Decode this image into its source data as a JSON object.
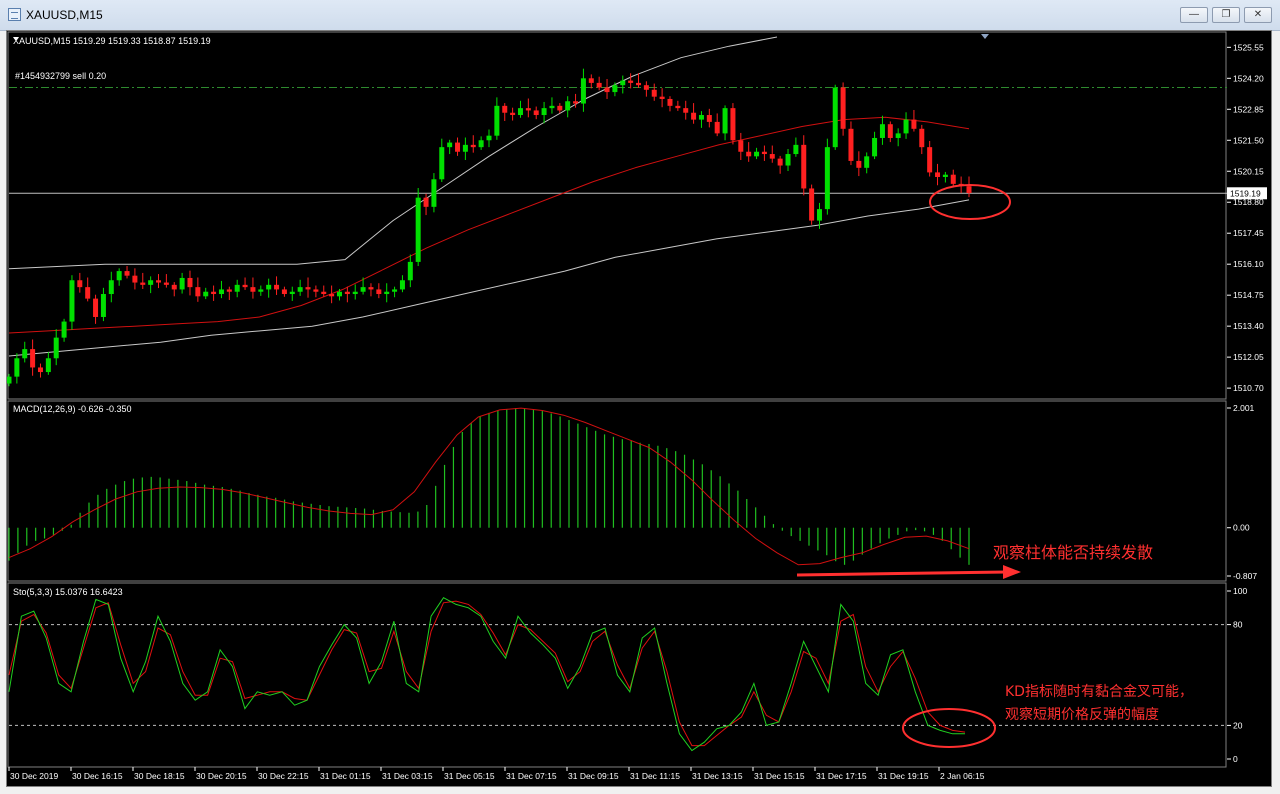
{
  "window": {
    "title": "XAUUSD,M15",
    "buttons": [
      "minimize",
      "restore",
      "close"
    ]
  },
  "colors": {
    "background": "#000000",
    "bull_candle": "#00e000",
    "bear_candle": "#ff2020",
    "ma": "#d01010",
    "bands": "#c8c8c8",
    "macd_hist": "#20c020",
    "macd_signal": "#d01010",
    "sto_main": "#20d020",
    "sto_signal": "#e01010",
    "annotation": "#ff3030"
  },
  "chart_data": [
    {
      "type": "candlestick",
      "header": "XAUUSD,M15  1519.29 1519.33 1518.87 1519.19",
      "order_label": "#1454932799 sell 0.20",
      "order_level": 1523.8,
      "current_price": 1519.19,
      "current_price_label": "1519.19",
      "ylim": [
        1510.4,
        1526.0
      ],
      "y_ticks": [
        "1525.55",
        "1524.20",
        "1522.85",
        "1521.50",
        "1520.15",
        "1518.80",
        "1517.45",
        "1516.10",
        "1514.75",
        "1513.40",
        "1512.05",
        "1510.70"
      ],
      "x_ticks": [
        "30 Dec 2019",
        "30 Dec 16:15",
        "30 Dec 18:15",
        "30 Dec 20:15",
        "30 Dec 22:15",
        "31 Dec 01:15",
        "31 Dec 03:15",
        "31 Dec 05:15",
        "31 Dec 07:15",
        "31 Dec 09:15",
        "31 Dec 11:15",
        "31 Dec 13:15",
        "31 Dec 15:15",
        "31 Dec 17:15",
        "31 Dec 19:15",
        "2 Jan 06:15"
      ],
      "close_path": [
        1511.2,
        1512.0,
        1512.4,
        1511.6,
        1511.4,
        1512.0,
        1512.9,
        1513.6,
        1515.4,
        1515.1,
        1514.6,
        1513.8,
        1514.8,
        1515.4,
        1515.8,
        1515.6,
        1515.3,
        1515.2,
        1515.4,
        1515.3,
        1515.2,
        1515.0,
        1515.5,
        1515.1,
        1514.7,
        1514.9,
        1514.8,
        1515.0,
        1514.9,
        1515.2,
        1515.1,
        1514.9,
        1515.0,
        1515.2,
        1515.0,
        1514.8,
        1514.9,
        1515.1,
        1515.0,
        1514.9,
        1514.8,
        1514.7,
        1514.9,
        1514.8,
        1514.9,
        1515.1,
        1515.0,
        1514.8,
        1514.9,
        1515.0,
        1515.4,
        1516.2,
        1519.0,
        1518.6,
        1519.8,
        1521.2,
        1521.4,
        1521.0,
        1521.3,
        1521.2,
        1521.5,
        1521.7,
        1523.0,
        1522.7,
        1522.6,
        1522.9,
        1522.8,
        1522.6,
        1522.9,
        1523.0,
        1522.8,
        1523.2,
        1523.1,
        1524.2,
        1524.0,
        1523.8,
        1523.6,
        1523.9,
        1524.1,
        1524.0,
        1523.9,
        1523.7,
        1523.4,
        1523.3,
        1523.0,
        1522.9,
        1522.7,
        1522.4,
        1522.6,
        1522.3,
        1521.8,
        1522.9,
        1521.5,
        1521.0,
        1520.8,
        1521.0,
        1520.9,
        1520.7,
        1520.4,
        1520.9,
        1521.3,
        1519.4,
        1518.0,
        1518.5,
        1521.2,
        1523.8,
        1522.0,
        1520.6,
        1520.3,
        1520.8,
        1521.6,
        1522.2,
        1521.6,
        1521.8,
        1522.4,
        1522.0,
        1521.2,
        1520.1,
        1519.9,
        1520.0,
        1519.6,
        1519.5,
        1519.2
      ],
      "series": [
        {
          "name": "candles_close",
          "values": "close_path"
        },
        {
          "name": "ma",
          "values": [
            1513.1,
            1513.2,
            1513.3,
            1513.4,
            1513.5,
            1513.6,
            1513.8,
            1514.3,
            1515.0,
            1515.9,
            1516.8,
            1517.6,
            1518.3,
            1519.0,
            1519.7,
            1520.3,
            1520.8,
            1521.3,
            1521.7,
            1522.1,
            1522.4,
            1522.5,
            1522.3,
            1522.0
          ]
        },
        {
          "name": "upper_band",
          "values": [
            1515.9,
            1516.0,
            1516.1,
            1516.1,
            1516.1,
            1516.1,
            1516.1,
            1516.3,
            1518.0,
            1519.4,
            1520.8,
            1522.1,
            1523.3,
            1524.3,
            1525.1,
            1525.6,
            1526.0
          ]
        },
        {
          "name": "lower_band",
          "values": [
            1512.1,
            1512.3,
            1512.5,
            1512.7,
            1513.0,
            1513.2,
            1513.4,
            1513.8,
            1514.3,
            1514.8,
            1515.3,
            1515.8,
            1516.4,
            1516.8,
            1517.2,
            1517.5,
            1517.8,
            1518.2,
            1518.5,
            1518.9
          ]
        }
      ]
    },
    {
      "type": "bar",
      "header": "MACD(12,26,9) -0.626 -0.350",
      "y_ticks": [
        "2.001",
        "0.00",
        "-0.807"
      ],
      "ylim": [
        -0.807,
        2.001
      ],
      "hist": [
        -0.55,
        -0.42,
        -0.3,
        -0.22,
        -0.18,
        -0.12,
        -0.05,
        0.05,
        0.25,
        0.42,
        0.55,
        0.65,
        0.72,
        0.78,
        0.82,
        0.84,
        0.85,
        0.84,
        0.82,
        0.8,
        0.78,
        0.75,
        0.72,
        0.7,
        0.68,
        0.65,
        0.62,
        0.58,
        0.55,
        0.52,
        0.5,
        0.47,
        0.44,
        0.42,
        0.4,
        0.38,
        0.36,
        0.35,
        0.34,
        0.33,
        0.32,
        0.3,
        0.28,
        0.27,
        0.26,
        0.25,
        0.27,
        0.38,
        0.7,
        1.05,
        1.35,
        1.6,
        1.75,
        1.86,
        1.92,
        1.96,
        1.98,
        2.0,
        2.0,
        1.98,
        1.95,
        1.91,
        1.86,
        1.8,
        1.74,
        1.68,
        1.62,
        1.56,
        1.52,
        1.48,
        1.45,
        1.42,
        1.4,
        1.37,
        1.33,
        1.28,
        1.22,
        1.14,
        1.06,
        0.96,
        0.86,
        0.74,
        0.62,
        0.48,
        0.34,
        0.2,
        0.06,
        -0.05,
        -0.14,
        -0.22,
        -0.3,
        -0.38,
        -0.46,
        -0.56,
        -0.62,
        -0.55,
        -0.45,
        -0.35,
        -0.26,
        -0.18,
        -0.12,
        -0.06,
        -0.04,
        -0.06,
        -0.12,
        -0.22,
        -0.36,
        -0.5,
        -0.62
      ],
      "series": [
        {
          "name": "signal",
          "values": [
            -0.5,
            -0.35,
            -0.15,
            0.1,
            0.3,
            0.48,
            0.6,
            0.66,
            0.68,
            0.67,
            0.64,
            0.58,
            0.5,
            0.42,
            0.34,
            0.28,
            0.24,
            0.22,
            0.3,
            0.6,
            1.1,
            1.55,
            1.85,
            1.97,
            2.0,
            1.96,
            1.88,
            1.76,
            1.62,
            1.48,
            1.34,
            1.1,
            0.8,
            0.45,
            0.12,
            -0.18,
            -0.42,
            -0.62,
            -0.6,
            -0.5,
            -0.42,
            -0.28,
            -0.16,
            -0.14,
            -0.22,
            -0.35
          ]
        }
      ]
    },
    {
      "type": "line",
      "header": "Sto(5,3,3) 15.0376 16.6423",
      "y_ticks": [
        "100",
        "80",
        "20",
        "0"
      ],
      "ylim": [
        0,
        100
      ],
      "levels": [
        80,
        20
      ],
      "series": [
        {
          "name": "main",
          "values": [
            40,
            85,
            88,
            72,
            45,
            40,
            70,
            95,
            92,
            60,
            40,
            58,
            85,
            70,
            45,
            35,
            40,
            65,
            55,
            30,
            40,
            38,
            40,
            32,
            35,
            55,
            68,
            80,
            72,
            45,
            58,
            82,
            45,
            40,
            85,
            96,
            92,
            90,
            85,
            70,
            60,
            85,
            75,
            68,
            60,
            42,
            55,
            75,
            78,
            50,
            40,
            72,
            78,
            45,
            15,
            5,
            10,
            18,
            20,
            28,
            45,
            20,
            22,
            45,
            70,
            55,
            40,
            92,
            82,
            45,
            38,
            62,
            65,
            40,
            20,
            17,
            15,
            15
          ]
        },
        {
          "name": "signal",
          "values": [
            50,
            82,
            86,
            75,
            50,
            42,
            66,
            90,
            93,
            68,
            45,
            52,
            78,
            74,
            52,
            38,
            38,
            60,
            58,
            36,
            38,
            40,
            40,
            36,
            35,
            50,
            65,
            77,
            75,
            52,
            54,
            76,
            52,
            42,
            76,
            93,
            94,
            92,
            86,
            75,
            62,
            80,
            77,
            70,
            63,
            46,
            52,
            70,
            76,
            56,
            42,
            66,
            76,
            52,
            22,
            8,
            8,
            14,
            20,
            25,
            40,
            26,
            22,
            40,
            64,
            60,
            45,
            82,
            86,
            55,
            40,
            55,
            64,
            48,
            28,
            20,
            17,
            16
          ]
        }
      ]
    }
  ],
  "annotations": {
    "macd_note": "观察柱体能否持续发散",
    "kd_note_line1": "KD指标随时有黏合金叉可能，",
    "kd_note_line2": "观察短期价格反弹的幅度"
  }
}
